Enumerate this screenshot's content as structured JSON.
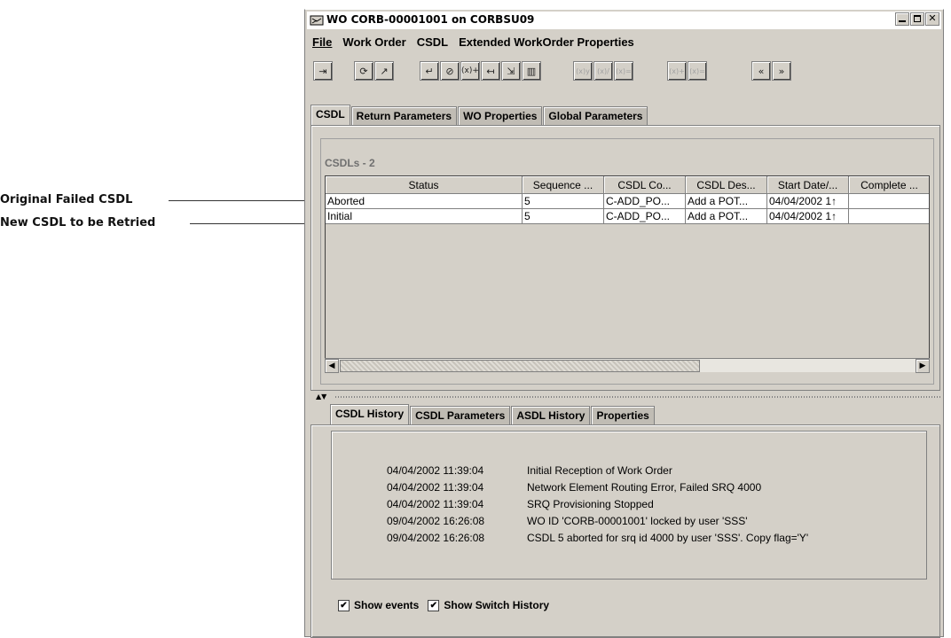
{
  "annotations": {
    "original_failed": "Original Failed CSDL",
    "new_retry": "New CSDL to be Retried"
  },
  "window": {
    "title": "WO CORB-00001001 on CORBSU09",
    "buttons": [
      "minimize",
      "maximize",
      "close"
    ]
  },
  "menu": [
    {
      "label": "File",
      "mnemonic": "F"
    },
    {
      "label": "Work Order",
      "mnemonic": "W"
    },
    {
      "label": "CSDL",
      "mnemonic": "C"
    },
    {
      "label": "Extended WorkOrder Properties",
      "mnemonic": ""
    }
  ],
  "toolbar": {
    "buttons": [
      {
        "name": "exit-icon",
        "glyph": "⇥",
        "enabled": true
      },
      {
        "name": "refresh-icon",
        "glyph": "⟳",
        "enabled": true
      },
      {
        "name": "export-icon",
        "glyph": "↗",
        "enabled": true
      },
      {
        "name": "csdl-add-icon",
        "glyph": "↵",
        "enabled": true
      },
      {
        "name": "csdl-null-icon",
        "glyph": "⊘",
        "enabled": true
      },
      {
        "name": "param-add-icon",
        "glyph": "(x)+",
        "enabled": true
      },
      {
        "name": "csdl-retry-icon",
        "glyph": "↤",
        "enabled": true
      },
      {
        "name": "csdl-move-icon",
        "glyph": "⇲",
        "enabled": true
      },
      {
        "name": "csdl-split-icon",
        "glyph": "▥",
        "enabled": true
      },
      {
        "name": "param-plus-icon",
        "glyph": "(x)y",
        "enabled": false
      },
      {
        "name": "param-divide-icon",
        "glyph": "(x)/",
        "enabled": false
      },
      {
        "name": "param-equal-icon",
        "glyph": "(x)=",
        "enabled": false
      },
      {
        "name": "param-plus2-icon",
        "glyph": "(x)+",
        "enabled": false
      },
      {
        "name": "param-equal2-icon",
        "glyph": "(x)=",
        "enabled": false
      },
      {
        "name": "previous-icon",
        "glyph": "«",
        "enabled": true
      },
      {
        "name": "next-icon",
        "glyph": "»",
        "enabled": true
      }
    ]
  },
  "top_tabs": [
    "CSDL",
    "Return Parameters",
    "WO Properties",
    "Global Parameters"
  ],
  "csdl_table": {
    "label": "CSDLs - 2",
    "columns": [
      "Status",
      "Sequence ...",
      "CSDL Co...",
      "CSDL Des...",
      "Start Date/...",
      "Complete ..."
    ],
    "rows": [
      [
        "Aborted",
        "5",
        "C-ADD_PO...",
        "Add a POT...",
        "04/04/2002 1↑",
        ""
      ],
      [
        "Initial",
        "5",
        "C-ADD_PO...",
        "Add a POT...",
        "04/04/2002 1↑",
        ""
      ]
    ]
  },
  "bottom_tabs": [
    "CSDL History",
    "CSDL Parameters",
    "ASDL History",
    "Properties"
  ],
  "history": [
    {
      "date": "04/04/2002 11:39:04",
      "text": "Initial Reception of Work Order"
    },
    {
      "date": "04/04/2002 11:39:04",
      "text": "Network Element Routing Error, Failed SRQ 4000"
    },
    {
      "date": "04/04/2002 11:39:04",
      "text": "SRQ Provisioning Stopped"
    },
    {
      "date": "09/04/2002 16:26:08",
      "text": "WO ID 'CORB-00001001' locked by user 'SSS'"
    },
    {
      "date": "09/04/2002 16:26:08",
      "text": "CSDL 5 aborted for srq id 4000 by user 'SSS'. Copy flag='Y'"
    }
  ],
  "checkboxes": [
    {
      "label": "Show events",
      "checked": true
    },
    {
      "label": "Show Switch History",
      "checked": true
    }
  ]
}
